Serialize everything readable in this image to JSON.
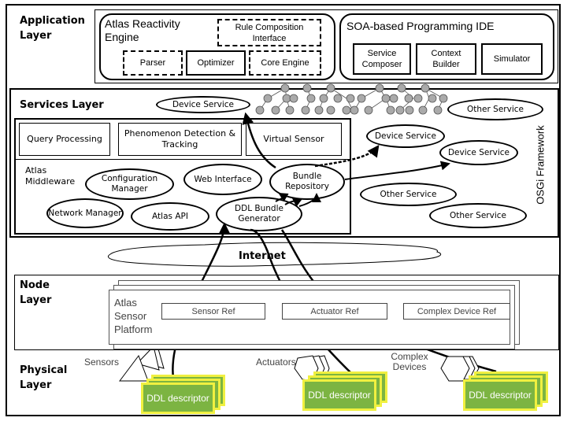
{
  "layers": {
    "application": "Application\nLayer",
    "services": "Services Layer",
    "node": "Node\nLayer",
    "physical": "Physical\nLayer",
    "osgi": "OSGi Framework",
    "internet": "Internet"
  },
  "application_layer": {
    "reactivity_engine": {
      "title": "Atlas Reactivity Engine",
      "rule_composition": "Rule Composition Interface",
      "parser": "Parser",
      "optimizer": "Optimizer",
      "core_engine": "Core Engine"
    },
    "ide": {
      "title": "SOA-based Programming IDE",
      "service_composer": "Service Composer",
      "context_builder": "Context Builder",
      "simulator": "Simulator"
    }
  },
  "services_layer": {
    "device_service_top": "Device Service",
    "query_processing": "Query Processing",
    "phenomenon": "Phenomenon Detection & Tracking",
    "virtual_sensor": "Virtual Sensor",
    "middleware": "Atlas Middleware",
    "configuration_manager": "Configuration Manager",
    "web_interface": "Web Interface",
    "bundle_repository": "Bundle Repository",
    "network_manager": "Network Manager",
    "atlas_api": "Atlas API",
    "ddl_bundle_generator": "DDL Bundle Generator",
    "osgi_services": [
      "Other Service",
      "Device Service",
      "Device Service",
      "Other Service",
      "Other Service"
    ]
  },
  "node_layer": {
    "platform": "Atlas Sensor Platform",
    "sensor_ref": "Sensor Ref",
    "actuator_ref": "Actuator Ref",
    "complex_ref": "Complex Device Ref"
  },
  "physical_layer": {
    "sensors": "Sensors",
    "actuators": "Actuators",
    "complex": "Complex Devices",
    "ddl": "DDL descriptor"
  },
  "colors": {
    "ddl_fill": "#7cb442",
    "ddl_glow": "#f0f040",
    "node_gray": "#aaaaaa"
  }
}
